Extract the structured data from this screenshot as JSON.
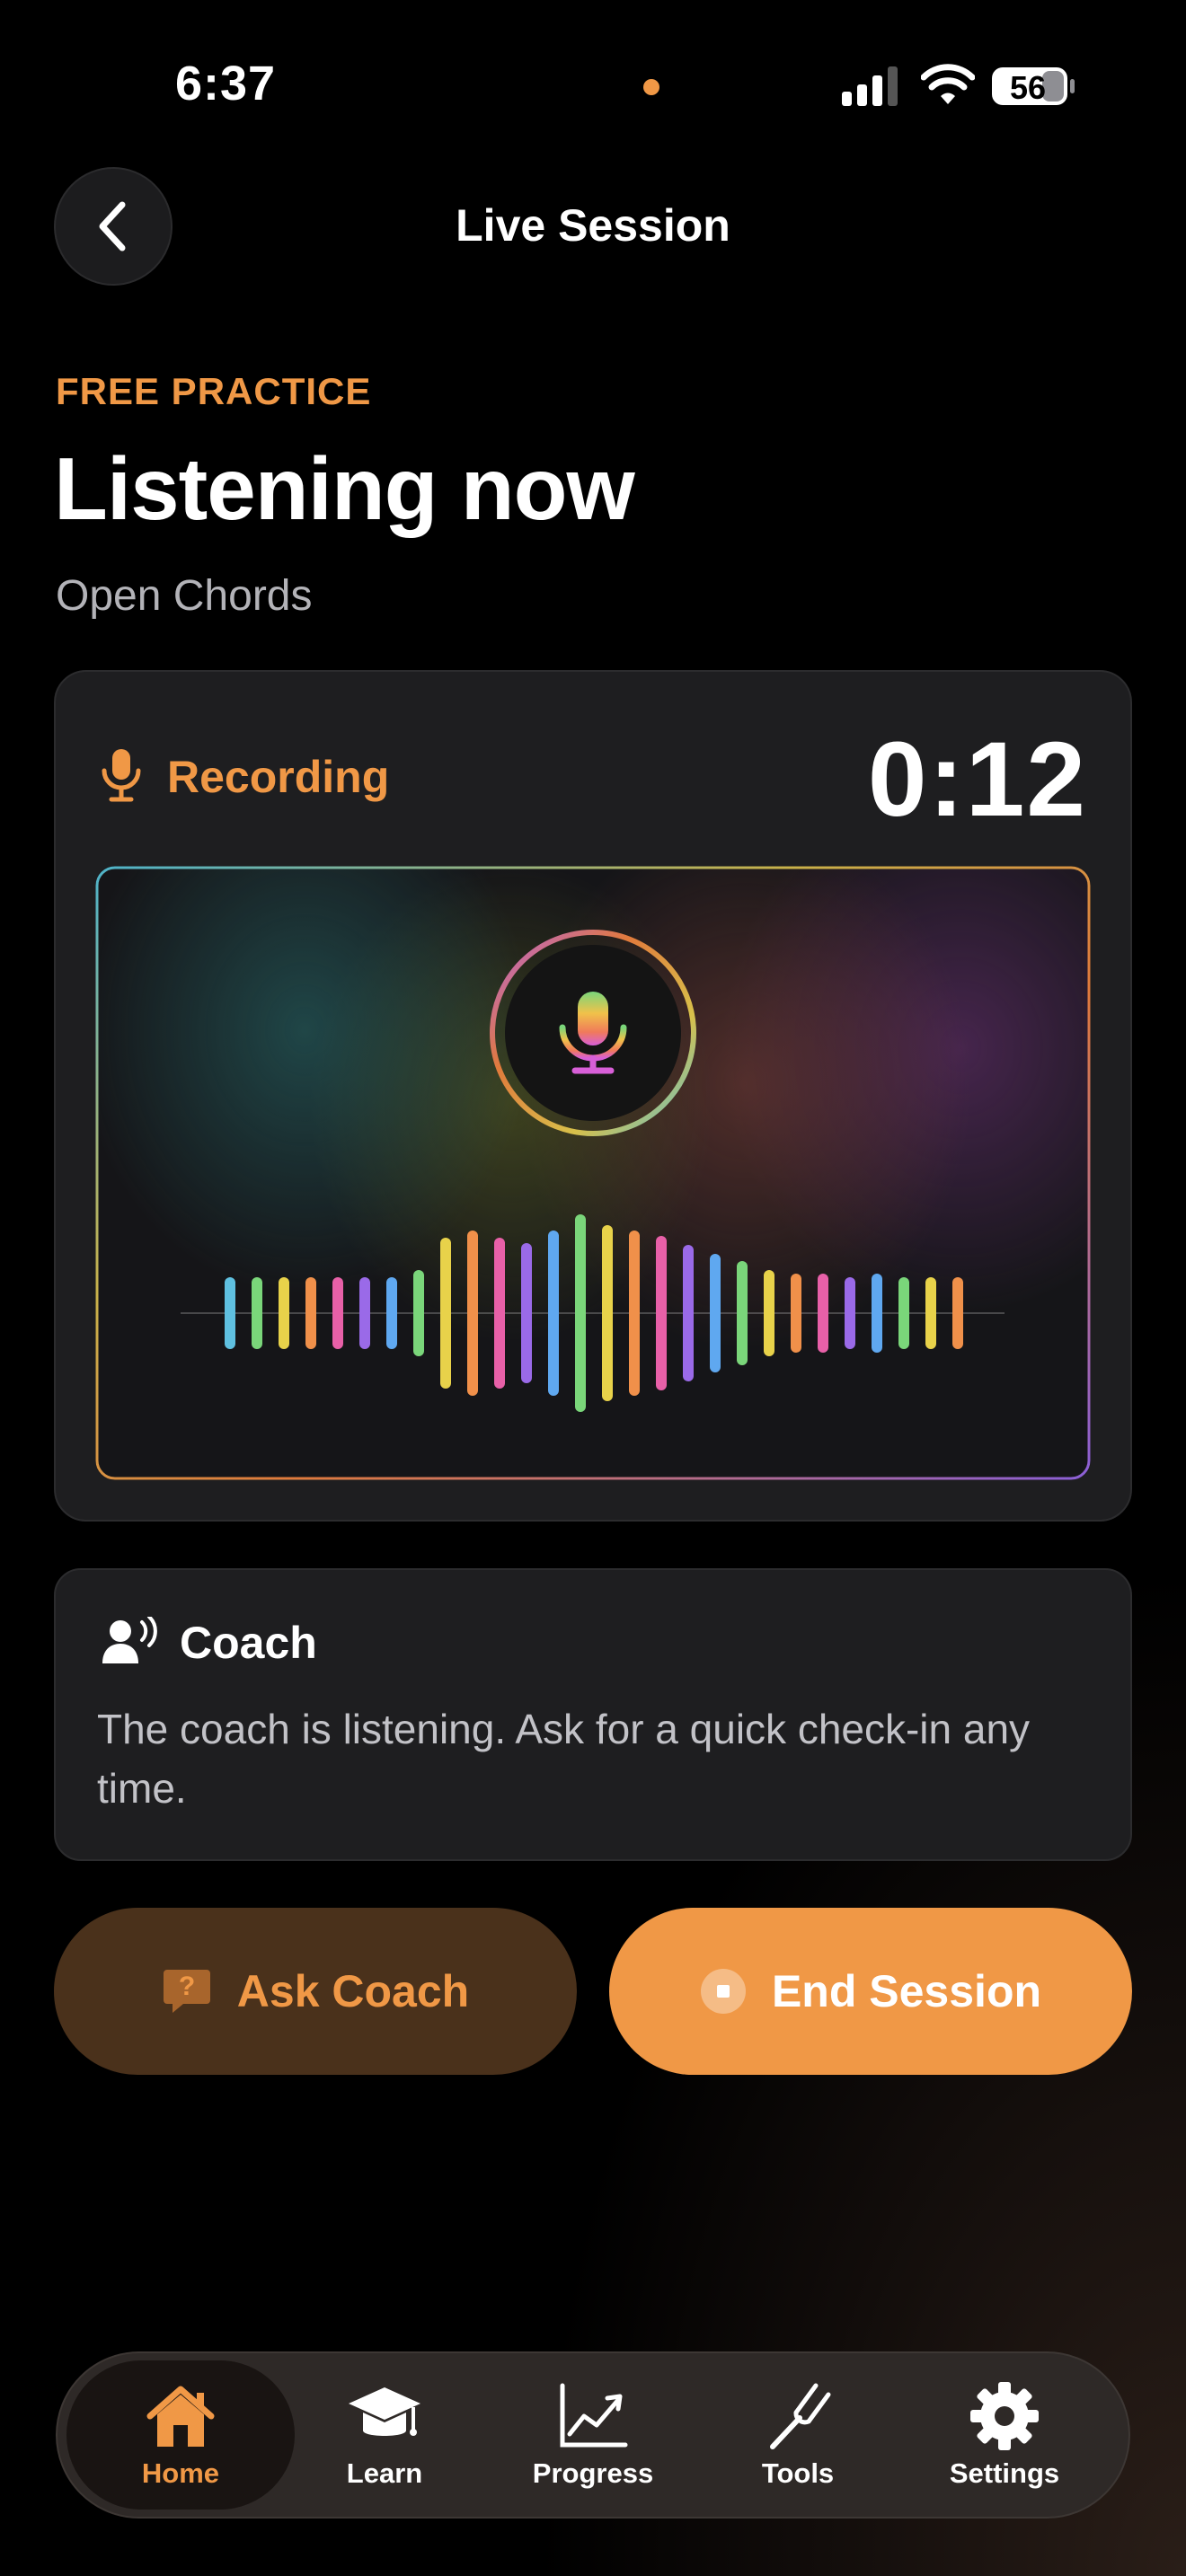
{
  "status_bar": {
    "time": "6:37",
    "battery": "56"
  },
  "header": {
    "title": "Live Session"
  },
  "session": {
    "eyebrow": "FREE PRACTICE",
    "headline": "Listening now",
    "subtitle": "Open Chords"
  },
  "recording": {
    "label": "Recording",
    "timer": "0:12"
  },
  "coach": {
    "title": "Coach",
    "message": "The coach is listening. Ask for a quick check-in any time."
  },
  "actions": {
    "ask_label": "Ask Coach",
    "end_label": "End Session"
  },
  "tabs": [
    {
      "label": "Home",
      "icon": "house-icon",
      "active": true
    },
    {
      "label": "Learn",
      "icon": "graduation-cap-icon",
      "active": false
    },
    {
      "label": "Progress",
      "icon": "chart-icon",
      "active": false
    },
    {
      "label": "Tools",
      "icon": "tuning-fork-icon",
      "active": false
    },
    {
      "label": "Settings",
      "icon": "gear-icon",
      "active": false
    }
  ],
  "colors": {
    "accent": "#f09846",
    "background": "#000000",
    "card": "#1e1e20"
  }
}
